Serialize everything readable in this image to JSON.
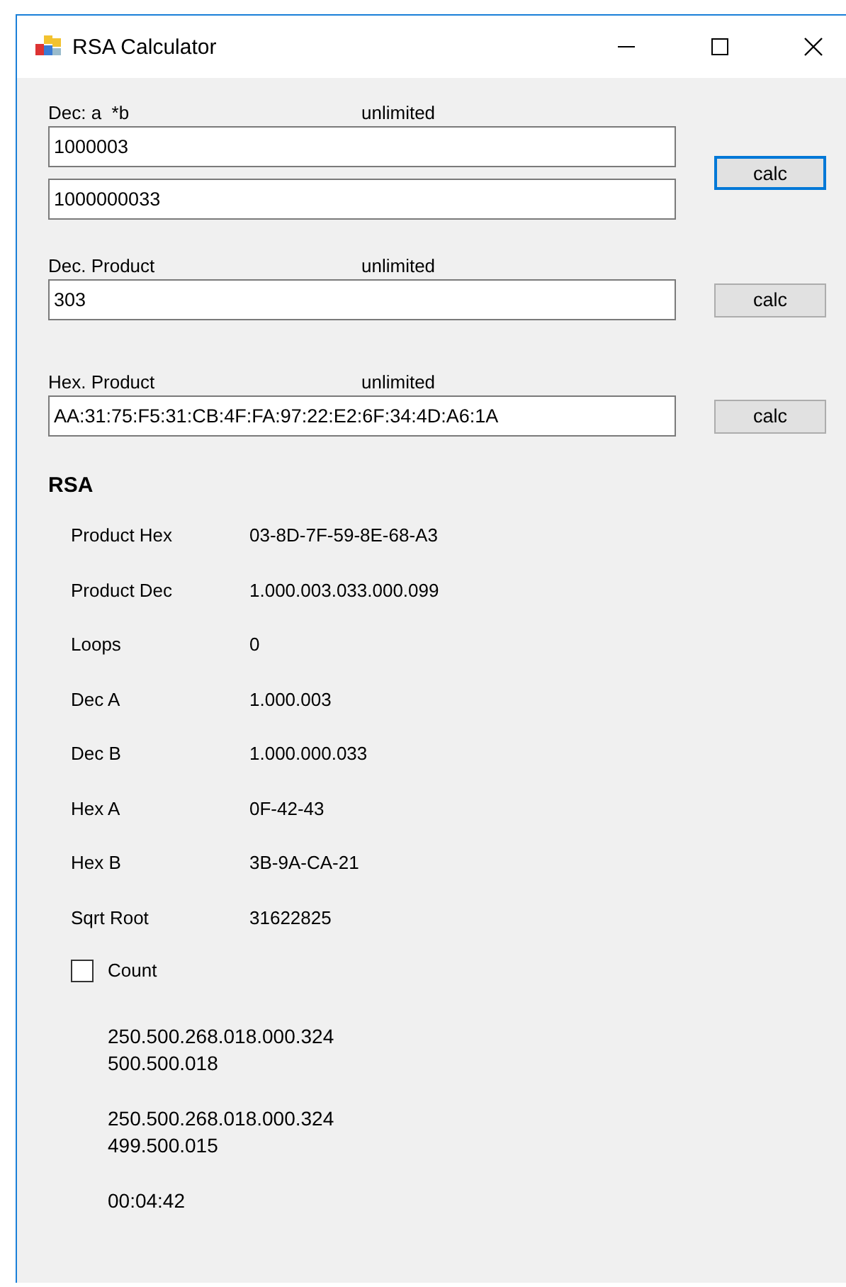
{
  "window": {
    "title": "RSA Calculator"
  },
  "inputs": [
    {
      "label": "Dec: a  *b",
      "limit": "unlimited",
      "fields": [
        "1000003",
        "1000000033"
      ],
      "button": {
        "label": "calc",
        "focused": true
      }
    },
    {
      "label": "Dec. Product",
      "limit": "unlimited",
      "fields": [
        "303"
      ],
      "button": {
        "label": "calc",
        "focused": false
      }
    },
    {
      "label": "Hex. Product",
      "limit": "unlimited",
      "fields": [
        "AA:31:75:F5:31:CB:4F:FA:97:22:E2:6F:34:4D:A6:1A"
      ],
      "button": {
        "label": "calc",
        "focused": false
      }
    }
  ],
  "rsa": {
    "title": "RSA",
    "rows": [
      {
        "label": "Product Hex",
        "value": "03-8D-7F-59-8E-68-A3"
      },
      {
        "label": "Product Dec",
        "value": "1.000.003.033.000.099"
      },
      {
        "label": "Loops",
        "value": "0"
      },
      {
        "label": "Dec A",
        "value": "1.000.003"
      },
      {
        "label": "Dec B",
        "value": "1.000.000.033"
      },
      {
        "label": "Hex A",
        "value": "0F-42-43"
      },
      {
        "label": "Hex B",
        "value": "3B-9A-CA-21"
      },
      {
        "label": "Sqrt Root",
        "value": "31622825"
      }
    ],
    "count": {
      "label": "Count",
      "checked": false
    },
    "results": [
      "250.500.268.018.000.324\n500.500.018",
      "250.500.268.018.000.324\n499.500.015",
      "00:04:42"
    ]
  }
}
